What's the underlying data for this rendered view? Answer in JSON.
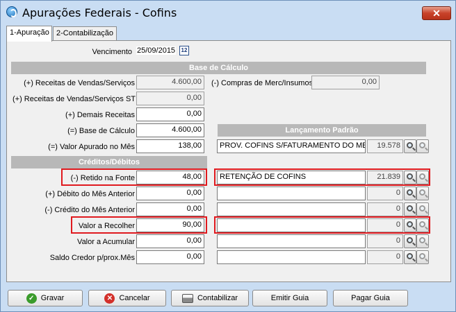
{
  "window": {
    "title": "Apurações Federais - Cofins",
    "close_glyph": "✕"
  },
  "tabs": [
    {
      "label": "1-Apuração"
    },
    {
      "label": "2-Contabilização"
    }
  ],
  "vencimento": {
    "label": "Vencimento",
    "value": "25/09/2015",
    "calendar_glyph": "12"
  },
  "base_calculo": {
    "header": "Base de Cálculo",
    "receitas_vendas": {
      "label": "(+) Receitas de Vendas/Serviços",
      "value": "4.600,00"
    },
    "receitas_vendas_st": {
      "label": "(+) Receitas de Vendas/Serviços ST",
      "value": "0,00"
    },
    "demais_receitas": {
      "label": "(+) Demais Receitas",
      "value": "0,00"
    },
    "base_calculo_row": {
      "label": "(=) Base de Cálculo",
      "value": "4.600,00"
    },
    "valor_apurado": {
      "label": "(=) Valor Apurado no Mês",
      "value": "138,00"
    },
    "compras": {
      "label": "(-) Compras de Merc/Insumos",
      "value": "0,00"
    }
  },
  "lancamento": {
    "header": "Lançamento Padrão",
    "description": "PROV. COFINS S/FATURAMENTO DO MES",
    "code": "19.578"
  },
  "creditos_debitos": {
    "header": "Créditos/Débitos",
    "rows": [
      {
        "label": "(-) Retido na Fonte",
        "value": "48,00",
        "desc": "RETENÇÃO DE COFINS",
        "code": "21.839"
      },
      {
        "label": "(+) Débito do Mês Anterior",
        "value": "0,00",
        "desc": "",
        "code": "0"
      },
      {
        "label": "(-) Crédito do Mês Anterior",
        "value": "0,00",
        "desc": "",
        "code": "0"
      },
      {
        "label": "Valor a Recolher",
        "value": "90,00",
        "desc": "",
        "code": "0"
      },
      {
        "label": "Valor a Acumular",
        "value": "0,00",
        "desc": "",
        "code": "0"
      },
      {
        "label": "Saldo Credor p/prox.Mês",
        "value": "0,00",
        "desc": "",
        "code": "0"
      }
    ]
  },
  "buttons": {
    "gravar": "Gravar",
    "cancelar": "Cancelar",
    "contabilizar": "Contabilizar",
    "emitir_guia": "Emitir Guia",
    "pagar_guia": "Pagar Guia",
    "ok_glyph": "✓",
    "cancel_glyph": "✕"
  },
  "colors": {
    "highlight_box": "#e0191e",
    "section_header": "#b8b8b8",
    "window_frame": "#c9ddf3"
  }
}
